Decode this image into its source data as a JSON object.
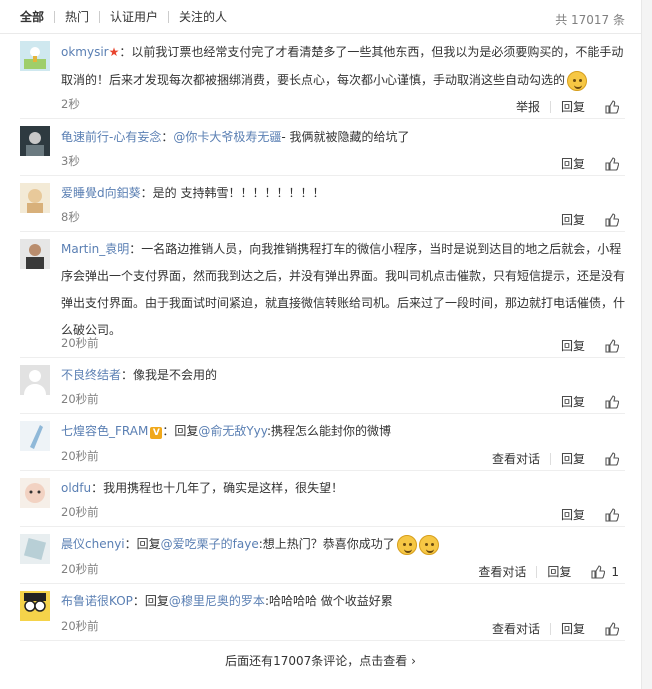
{
  "tabs": [
    "全部",
    "热门",
    "认证用户",
    "关注的人"
  ],
  "total": "共 17017 条",
  "actions": {
    "report": "举报",
    "reply": "回复",
    "view_thread": "查看对话"
  },
  "comments": [
    {
      "nick": "okmysir",
      "text": "：以前我订票也经常支付完了才看清楚多了一些其他东西，但我以为是必须要购买的，不能手动取消的！后来才发现每次都被捆绑消费，要长点心，每次都小心谨慎，手动取消这些自动勾选的",
      "time": "2秒"
    },
    {
      "nick": "龟速前行-心有妄念",
      "prefix": "：",
      "mention": "@你卡大爷极寿无疆",
      "text": "- 我俩就被隐藏的给坑了",
      "time": "3秒"
    },
    {
      "nick": "爱睡覺d向鈤葵",
      "text": "：是的 支持韩雪！！！！！！！！",
      "time": "8秒"
    },
    {
      "nick": "Martin_袁明",
      "text": "：一名路边推销人员，向我推销携程打车的微信小程序，当时是说到达目的地之后就会，小程序会弹出一个支付界面，然而我到达之后，并没有弹出界面。我叫司机点击催款，只有短信提示，还是没有弹出支付界面。由于我面试时间紧迫，就直接微信转账给司机。后来过了一段时间，那边就打电话催债，什么破公司。",
      "time": "20秒前"
    },
    {
      "nick": "不良终结者",
      "text": "：像我是不会用的",
      "time": "20秒前"
    },
    {
      "nick": "七煌容色_FRAM",
      "prefix": "：回复",
      "mention": "@俞无敌Yyy",
      "text": ":携程怎么能封你的微博",
      "time": "20秒前"
    },
    {
      "nick": "oldfu",
      "text": "：我用携程也十几年了，确实是这样，很失望！",
      "time": "20秒前"
    },
    {
      "nick": "晨仪chenyi",
      "prefix": "：回复",
      "mention": "@爱吃栗子的faye",
      "text": ":想上热门？恭喜你成功了",
      "time": "20秒前",
      "likes": "1"
    },
    {
      "nick": "布鲁诺很KOP",
      "prefix": "：回复",
      "mention": "@穆里尼奥的罗本",
      "text": ":哈哈哈哈 做个收益好累",
      "time": "20秒前"
    }
  ],
  "more_text": "后面还有17007条评论，点击查看",
  "more_icon": "chevron-right-icon"
}
